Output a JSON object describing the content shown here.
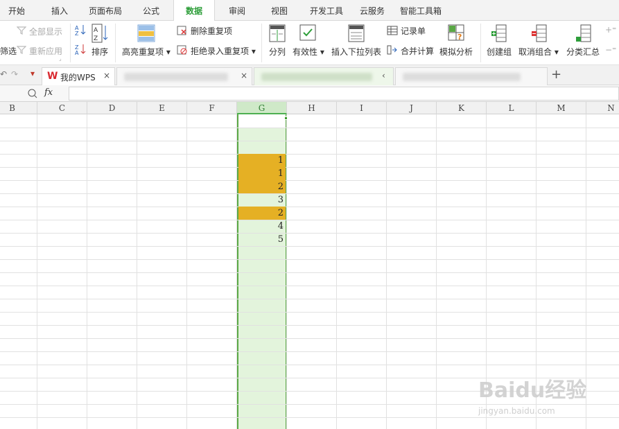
{
  "menu": {
    "tabs": [
      "开始",
      "插入",
      "页面布局",
      "公式",
      "数据",
      "审阅",
      "视图",
      "开发工具",
      "云服务",
      "智能工具箱"
    ],
    "active": "数据"
  },
  "ribbon": {
    "show_all": "全部显示",
    "reapply": "重新应用",
    "filter_partial": "筛选",
    "sort": "排序",
    "highlight_dup": "高亮重复项",
    "remove_dup": "删除重复项",
    "reject_dup": "拒绝录入重复项",
    "split": "分列",
    "validity": "有效性",
    "insert_dropdown": "插入下拉列表",
    "record_form": "记录单",
    "consolidate": "合并计算",
    "what_if": "模拟分析",
    "create_group": "创建组",
    "ungroup": "取消组合",
    "subtotal": "分类汇总"
  },
  "doc_tabs": {
    "wps_tab": "我的WPS",
    "new_tab": "+"
  },
  "formula_bar": {
    "fx": "fx",
    "value": ""
  },
  "columns": [
    "B",
    "C",
    "D",
    "E",
    "F",
    "G",
    "H",
    "I",
    "J",
    "K",
    "L",
    "M",
    "N"
  ],
  "selected_column": "G",
  "cells_g": [
    "",
    "",
    "",
    "1",
    "1",
    "2",
    "3",
    "2",
    "4",
    "5"
  ],
  "highlighted_rows": [
    3,
    4,
    5,
    7
  ],
  "colors": {
    "accent": "#2e9e3a",
    "highlight": "#e5b024",
    "selection": "#e3f4dc"
  },
  "watermark": {
    "main": "Baidu经验",
    "sub": "jingyan.baidu.com"
  }
}
